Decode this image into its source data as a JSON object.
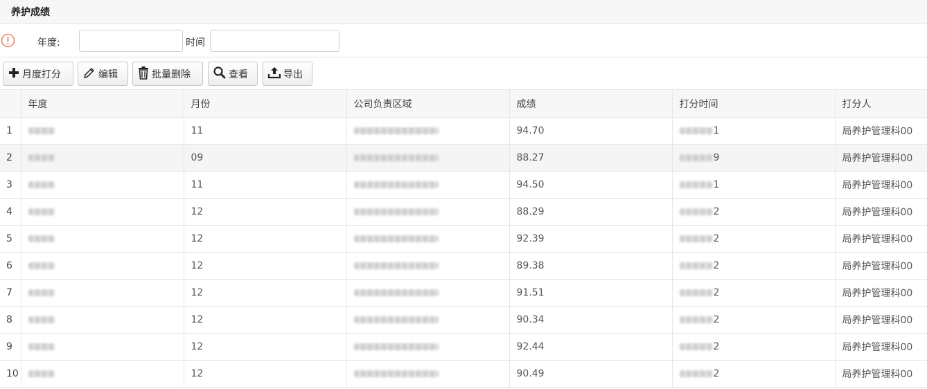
{
  "panel": {
    "title": "养护成绩"
  },
  "search": {
    "year_label": "年度:",
    "year_value": "",
    "time_label": "时间",
    "time_value": ""
  },
  "toolbar": {
    "monthly_score_label": "月度打分",
    "edit_label": "编辑",
    "batch_delete_label": "批量删除",
    "view_label": "查看",
    "export_label": "导出"
  },
  "table": {
    "columns": [
      "",
      "年度",
      "月份",
      "公司负责区域",
      "成绩",
      "打分时间",
      "打分人"
    ],
    "rows": [
      {
        "index": "1",
        "month": "11",
        "score": "94.70",
        "time_tail": "1",
        "scorer": "局养护管理科00"
      },
      {
        "index": "2",
        "month": "09",
        "score": "88.27",
        "time_tail": "9",
        "scorer": "局养护管理科00"
      },
      {
        "index": "3",
        "month": "11",
        "score": "94.50",
        "time_tail": "1",
        "scorer": "局养护管理科00"
      },
      {
        "index": "4",
        "month": "12",
        "score": "88.29",
        "time_tail": "2",
        "scorer": "局养护管理科00"
      },
      {
        "index": "5",
        "month": "12",
        "score": "92.39",
        "time_tail": "2",
        "scorer": "局养护管理科00"
      },
      {
        "index": "6",
        "month": "12",
        "score": "89.38",
        "time_tail": "2",
        "scorer": "局养护管理科00"
      },
      {
        "index": "7",
        "month": "12",
        "score": "91.51",
        "time_tail": "2",
        "scorer": "局养护管理科00"
      },
      {
        "index": "8",
        "month": "12",
        "score": "90.34",
        "time_tail": "2",
        "scorer": "局养护管理科00"
      },
      {
        "index": "9",
        "month": "12",
        "score": "92.44",
        "time_tail": "2",
        "scorer": "局养护管理科00"
      },
      {
        "index": "10",
        "month": "12",
        "score": "90.49",
        "time_tail": "2",
        "scorer": "局养护管理科00"
      }
    ]
  },
  "colors": {
    "warning": "#e9876b",
    "header_bg": "#f7f7f7",
    "border": "#e6e6e6",
    "alt_row": "#f5f5f5"
  },
  "icons": [
    "warning-icon",
    "plus-icon",
    "pencil-icon",
    "trash-icon",
    "magnifier-icon",
    "upload-icon"
  ]
}
